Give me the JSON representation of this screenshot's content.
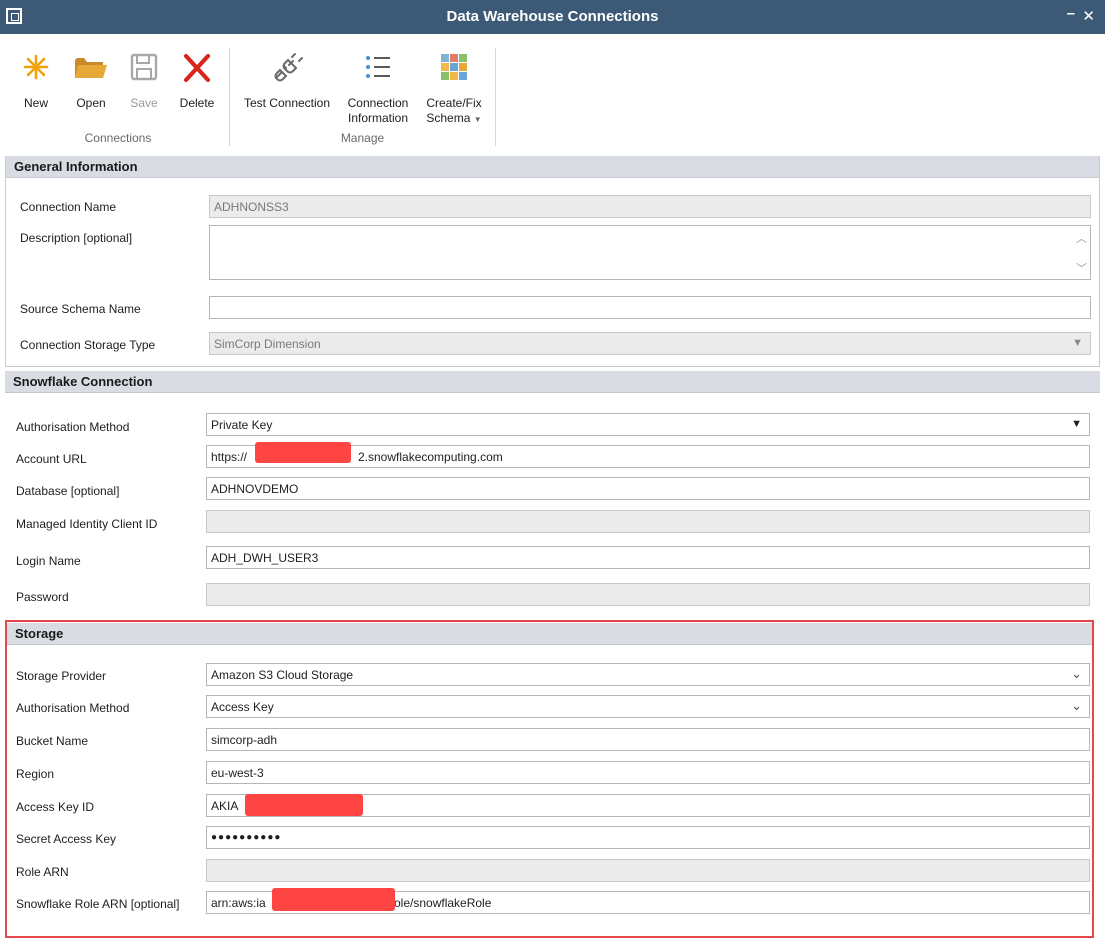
{
  "window": {
    "title": "Data Warehouse Connections",
    "minimize": "–",
    "close": "✕"
  },
  "ribbon": {
    "groups": [
      {
        "label": "Connections"
      },
      {
        "label": "Manage"
      }
    ],
    "buttons": {
      "new": "New",
      "open": "Open",
      "save": "Save",
      "delete": "Delete",
      "test_connection": "Test Connection",
      "connection_information_line1": "Connection",
      "connection_information_line2": "Information",
      "create_fix_schema_line1": "Create/Fix",
      "create_fix_schema_line2": "Schema"
    },
    "icons": {
      "new": "new-asterisk-icon",
      "open": "folder-open-icon",
      "save": "floppy-save-icon",
      "delete": "delete-x-icon",
      "test_connection": "plug-icon",
      "connection_information": "list-icon",
      "create_fix_schema": "grid-icon"
    }
  },
  "general": {
    "header": "General Information",
    "connection_name_label": "Connection Name",
    "connection_name_value": "ADHNONSS3",
    "description_label": "Description [optional]",
    "source_schema_label": "Source Schema Name",
    "source_schema_value": "",
    "storage_type_label": "Connection Storage Type",
    "storage_type_value": "SimCorp Dimension"
  },
  "snowflake": {
    "header": "Snowflake Connection",
    "auth_method_label": "Authorisation Method",
    "auth_method_value": "Private Key",
    "account_url_label": "Account URL",
    "account_url_prefix": "https://",
    "account_url_suffix": "2.snowflakecomputing.com",
    "database_label": "Database [optional]",
    "database_value": "ADHNOVDEMO",
    "managed_identity_label": "Managed Identity Client ID",
    "login_name_label": "Login Name",
    "login_name_value": "ADH_DWH_USER3",
    "password_label": "Password"
  },
  "storage": {
    "header": "Storage",
    "provider_label": "Storage Provider",
    "provider_value": "Amazon S3 Cloud Storage",
    "auth_method_label": "Authorisation Method",
    "auth_method_value": "Access Key",
    "bucket_label": "Bucket Name",
    "bucket_value": "simcorp-adh",
    "region_label": "Region",
    "region_value": "eu-west-3",
    "access_key_label": "Access Key ID",
    "access_key_prefix": "AKIA",
    "secret_key_label": "Secret Access Key",
    "secret_key_value": "●●●●●●●●●●",
    "role_arn_label": "Role ARN",
    "snowflake_role_label": "Snowflake Role ARN [optional]",
    "snowflake_role_prefix": "arn:aws:ia",
    "snowflake_role_suffix": "ole/snowflakeRole"
  },
  "colors": {
    "titlebar": "#3c5a76",
    "section_header": "#d9dde3",
    "highlight": "#e5474b",
    "redaction": "#ff4444",
    "delete_icon": "#d9251d",
    "new_icon": "#f0a30a"
  }
}
